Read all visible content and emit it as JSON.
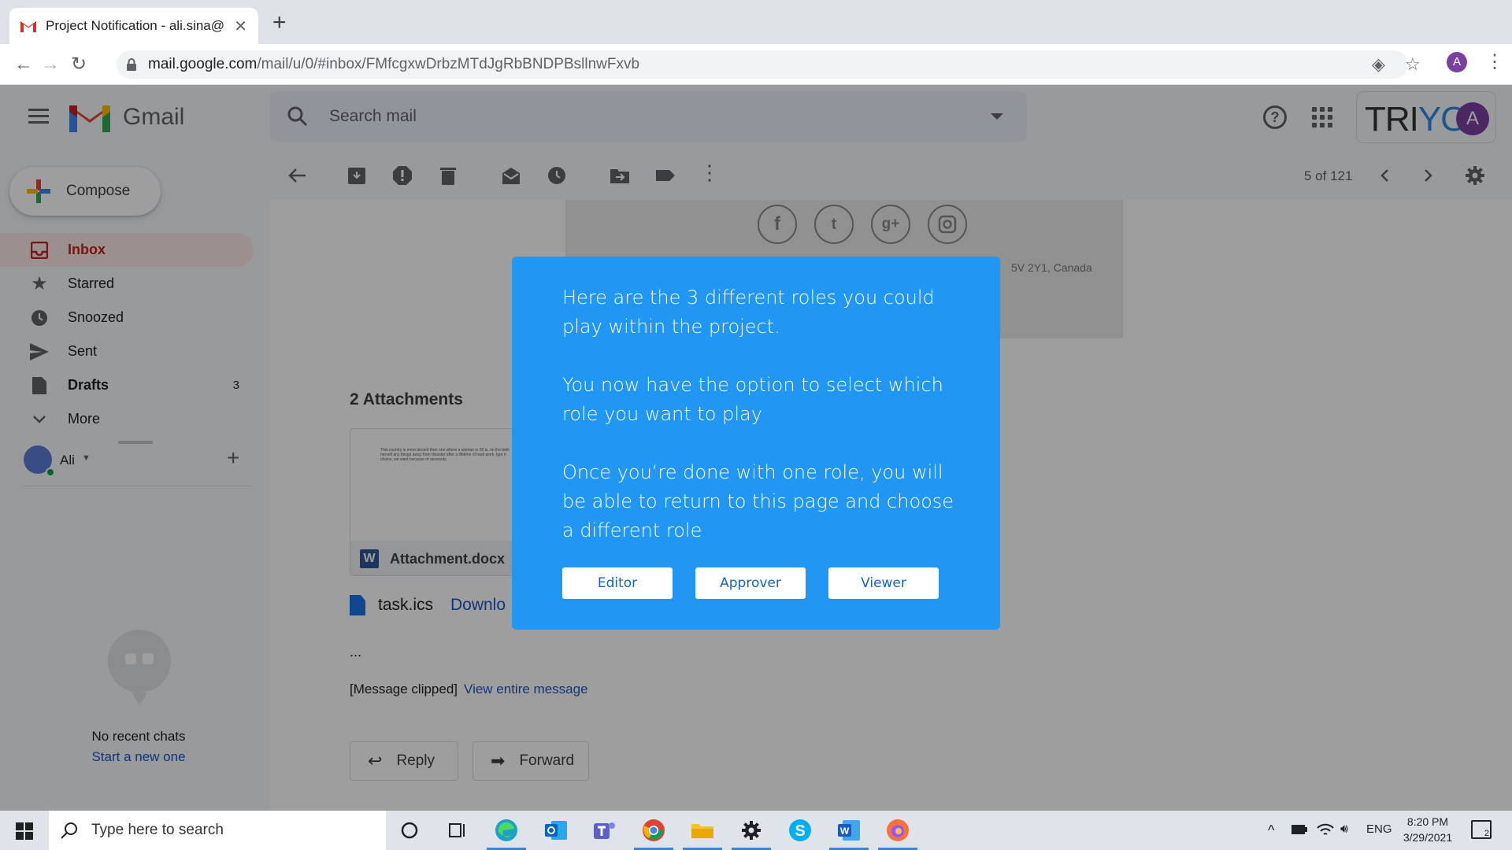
{
  "browser": {
    "tab_title": "Project Notification - ali.sina@",
    "url_domain": "mail.google.com",
    "url_path": "/mail/u/0/#inbox/FMfcgxwDrbzMTdJgRbBNDPBsllnwFxvb",
    "profile_initial": "A"
  },
  "gmail": {
    "product_name": "Gmail",
    "search_placeholder": "Search mail",
    "brand_logo_text": "TRIYO",
    "account_initial": "A",
    "compose_label": "Compose",
    "nav": [
      {
        "label": "Inbox",
        "icon": "inbox-icon",
        "count": ""
      },
      {
        "label": "Starred",
        "icon": "star-icon",
        "count": ""
      },
      {
        "label": "Snoozed",
        "icon": "clock-icon",
        "count": ""
      },
      {
        "label": "Sent",
        "icon": "send-icon",
        "count": ""
      },
      {
        "label": "Drafts",
        "icon": "draft-icon",
        "count": "3"
      },
      {
        "label": "More",
        "icon": "chevron-down-icon",
        "count": ""
      }
    ],
    "hangouts_user": "Ali",
    "no_chats": "No recent chats",
    "start_new": "Start a new one",
    "pager": "5 of 121"
  },
  "email": {
    "address_fragment": "5V 2Y1, Canada",
    "attachments_title": "2 Attachments",
    "attachment_preview": "This country is more decent than one where a woman in 28 is, on the both herself any things away from disaster after a lifetime of hard work. Igor it choice, we want because of necessity.",
    "attachment_filename": "Attachment.docx",
    "ics_filename": "task.ics",
    "ics_download": "Downlo",
    "ellipsis": "...",
    "clipped_text": "[Message clipped]",
    "view_entire": "View entire message",
    "reply_label": "Reply",
    "forward_label": "Forward"
  },
  "modal": {
    "paragraph1": "Here are the 3 different roles you could play within the project.",
    "paragraph2": "You now have the option to select which role you want to play",
    "paragraph3": "Once you’re done with one role, you will be able to return to this page and choose a different role",
    "buttons": [
      "Editor",
      "Approver",
      "Viewer"
    ],
    "accent_color": "#2196f3"
  },
  "taskbar": {
    "search_placeholder": "Type here to search",
    "language": "ENG",
    "time": "8:20 PM",
    "date": "3/29/2021",
    "notification_count": "2"
  }
}
